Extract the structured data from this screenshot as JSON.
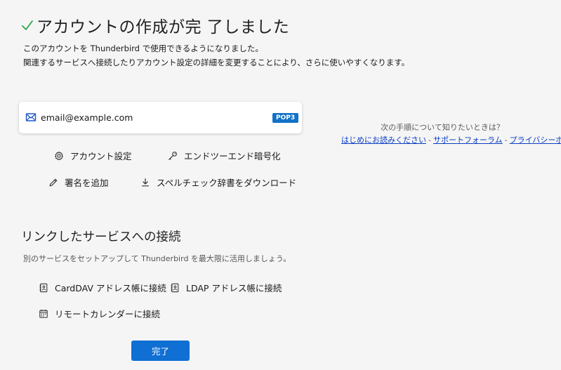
{
  "header": {
    "title": "アカウントの作成が完 了しました",
    "subtitle_line1": "このアカウントを Thunderbird で使用できるようになりました。",
    "subtitle_line2": "関連するサービスへ接続したりアカウント設定の詳細を変更することにより、さらに使いやすくなります。"
  },
  "account": {
    "email": "email@example.com",
    "badge": "POP3",
    "icon": "mail-icon"
  },
  "actions": {
    "settings": "アカウント設定",
    "e2e": "エンドツーエンド暗号化",
    "signature": "署名を追加",
    "spellcheck": "スペルチェック辞書をダウンロード"
  },
  "help": {
    "question": "次の手順について知りたいときは？",
    "links": [
      "はじめにお読みください",
      "サポートフォーラム",
      "プライバシーポリシー"
    ],
    "separator": "-"
  },
  "linked": {
    "heading": "リンクしたサービスへの接続",
    "description": "別のサービスをセットアップして Thunderbird を最大限に活用しましょう。",
    "carddav": "CardDAV アドレス帳に接続",
    "ldap": "LDAP アドレス帳に接続",
    "calendar": "リモートカレンダーに接続"
  },
  "done_button": "完了",
  "colors": {
    "accent": "#0f6fd3",
    "check": "#2ea44f",
    "link": "#0b3ec4",
    "badge": "#1272c8"
  }
}
